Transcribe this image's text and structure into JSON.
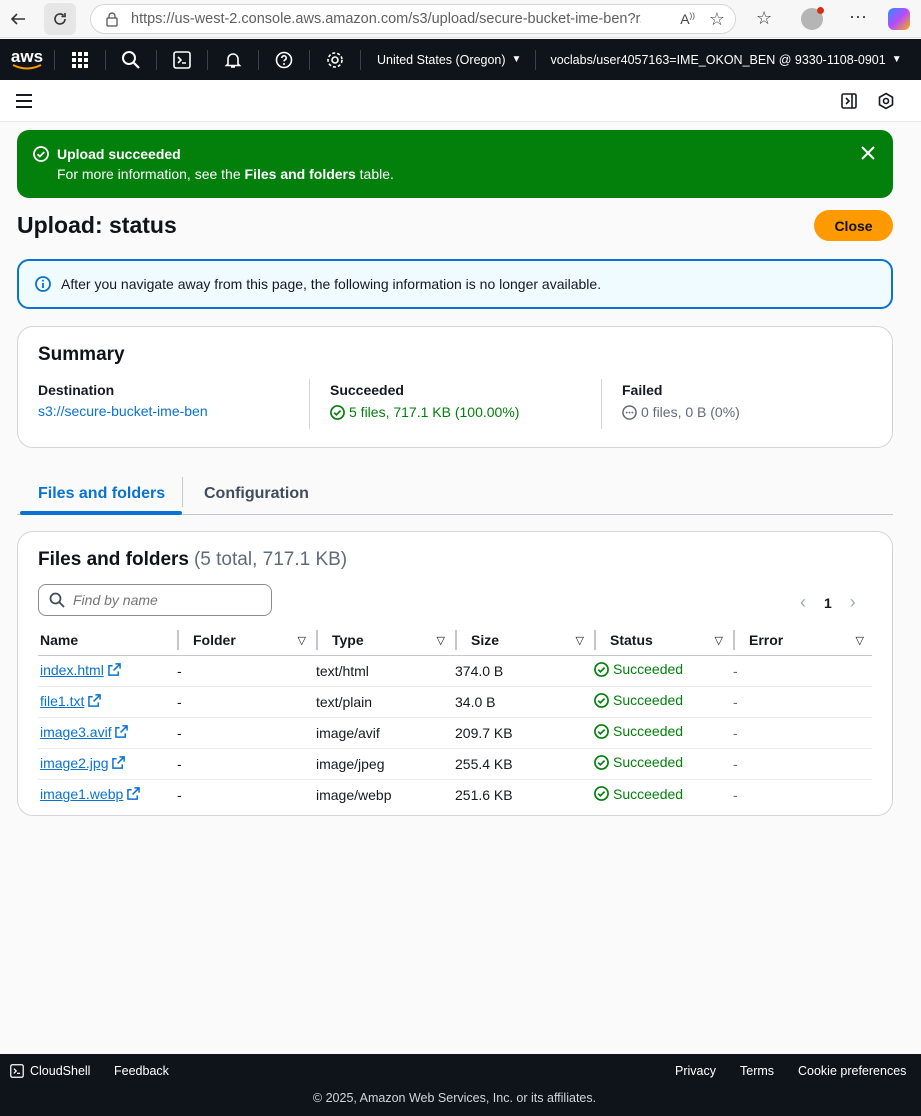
{
  "browser": {
    "url": "https://us-west-2.console.aws.amazon.com/s3/upload/secure-bucket-ime-ben?r..."
  },
  "topnav": {
    "logo": "aws",
    "region": "United States (Oregon)",
    "account": "voclabs/user4057163=IME_OKON_BEN @ 9330-1108-0901"
  },
  "flash": {
    "title": "Upload succeeded",
    "message_prefix": "For more information, see the ",
    "message_bold": "Files and folders",
    "message_suffix": " table."
  },
  "page": {
    "title": "Upload: status",
    "close_label": "Close"
  },
  "info_alert": {
    "text": "After you navigate away from this page, the following information is no longer available."
  },
  "summary": {
    "title": "Summary",
    "destination_label": "Destination",
    "destination_value": "s3://secure-bucket-ime-ben",
    "succeeded_label": "Succeeded",
    "succeeded_value": "5 files, 717.1 KB (100.00%)",
    "failed_label": "Failed",
    "failed_value": "0 files, 0 B (0%)"
  },
  "tabs": [
    {
      "label": "Files and folders",
      "active": true
    },
    {
      "label": "Configuration",
      "active": false
    }
  ],
  "files": {
    "title": "Files and folders",
    "count_text": "(5 total, 717.1 KB)",
    "search_placeholder": "Find by name",
    "page_number": "1",
    "columns": [
      "Name",
      "Folder",
      "Type",
      "Size",
      "Status",
      "Error"
    ],
    "rows": [
      {
        "name": "index.html",
        "folder": "-",
        "type": "text/html",
        "size": "374.0 B",
        "status": "Succeeded",
        "error": "-"
      },
      {
        "name": "file1.txt",
        "folder": "-",
        "type": "text/plain",
        "size": "34.0 B",
        "status": "Succeeded",
        "error": "-"
      },
      {
        "name": "image3.avif",
        "folder": "-",
        "type": "image/avif",
        "size": "209.7 KB",
        "status": "Succeeded",
        "error": "-"
      },
      {
        "name": "image2.jpg",
        "folder": "-",
        "type": "image/jpeg",
        "size": "255.4 KB",
        "status": "Succeeded",
        "error": "-"
      },
      {
        "name": "image1.webp",
        "folder": "-",
        "type": "image/webp",
        "size": "251.6 KB",
        "status": "Succeeded",
        "error": "-"
      }
    ]
  },
  "footer": {
    "cloudshell": "CloudShell",
    "feedback": "Feedback",
    "privacy": "Privacy",
    "terms": "Terms",
    "cookies": "Cookie preferences",
    "copyright": "© 2025, Amazon Web Services, Inc. or its affiliates."
  },
  "colors": {
    "success": "#037f0c",
    "link": "#0972d3",
    "primary_button": "#ff9900",
    "nav_bg": "#0f141a"
  }
}
